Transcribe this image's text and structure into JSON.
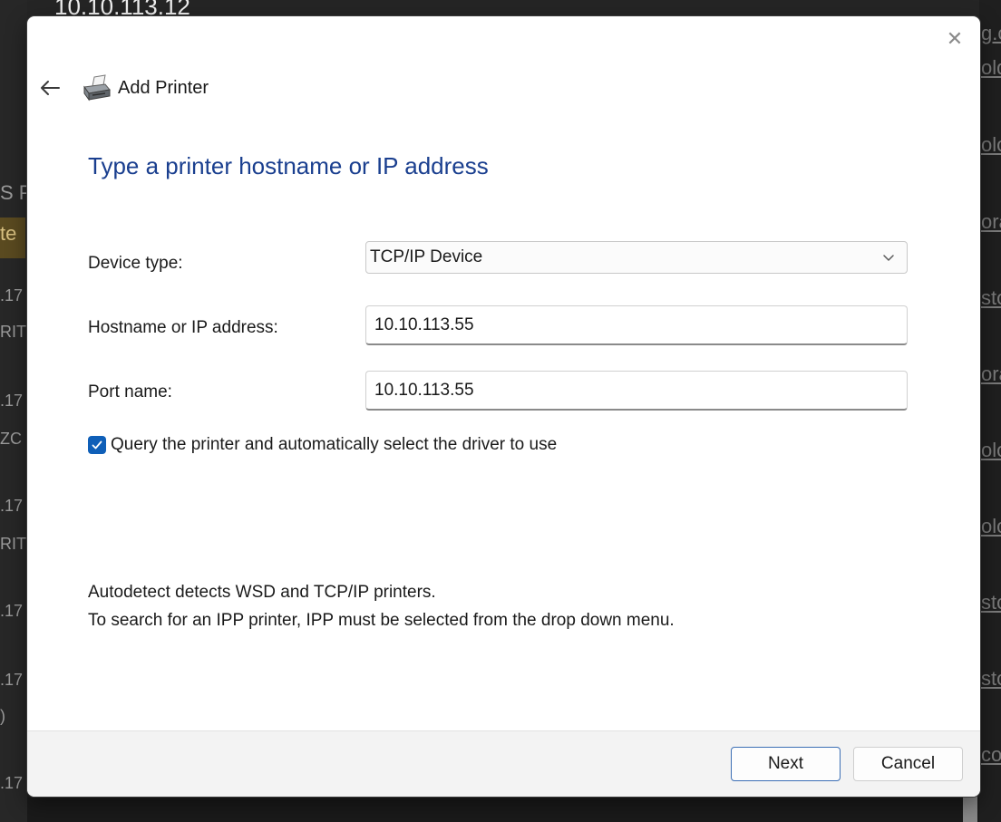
{
  "background": {
    "title": "10.10.113.12",
    "left_fragments": [
      "S P",
      "te",
      ".17",
      "RITE",
      ".17",
      "ZC",
      ".17",
      "RITE",
      ".17",
      ".17",
      ")",
      ".17"
    ],
    "right_fragments": [
      "g.c",
      "old",
      "olo",
      "ora",
      "sto",
      "ora",
      "olo",
      "olo",
      "sto",
      "sto",
      "co"
    ]
  },
  "dialog": {
    "header_title": "Add Printer",
    "page_title": "Type a printer hostname or IP address",
    "device_type_label": "Device type:",
    "device_type_value": "TCP/IP Device",
    "hostname_label": "Hostname or IP address:",
    "hostname_value": "10.10.113.55",
    "port_label": "Port name:",
    "port_value": "10.10.113.55",
    "query_checkbox_label": "Query the printer and automatically select the driver to use",
    "query_checked": true,
    "info_line1": "Autodetect detects WSD and TCP/IP printers.",
    "info_line2": "To search for an IPP printer, IPP must be selected from the drop down menu.",
    "next_label": "Next",
    "cancel_label": "Cancel",
    "close_glyph": "✕"
  },
  "colors": {
    "title_blue": "#1a3f8f",
    "accent": "#0f5fb8"
  },
  "icons": {
    "back": "back-arrow-icon",
    "printer": "printer-icon",
    "close": "close-icon",
    "chevron": "chevron-down-icon",
    "check": "checkmark-icon"
  }
}
